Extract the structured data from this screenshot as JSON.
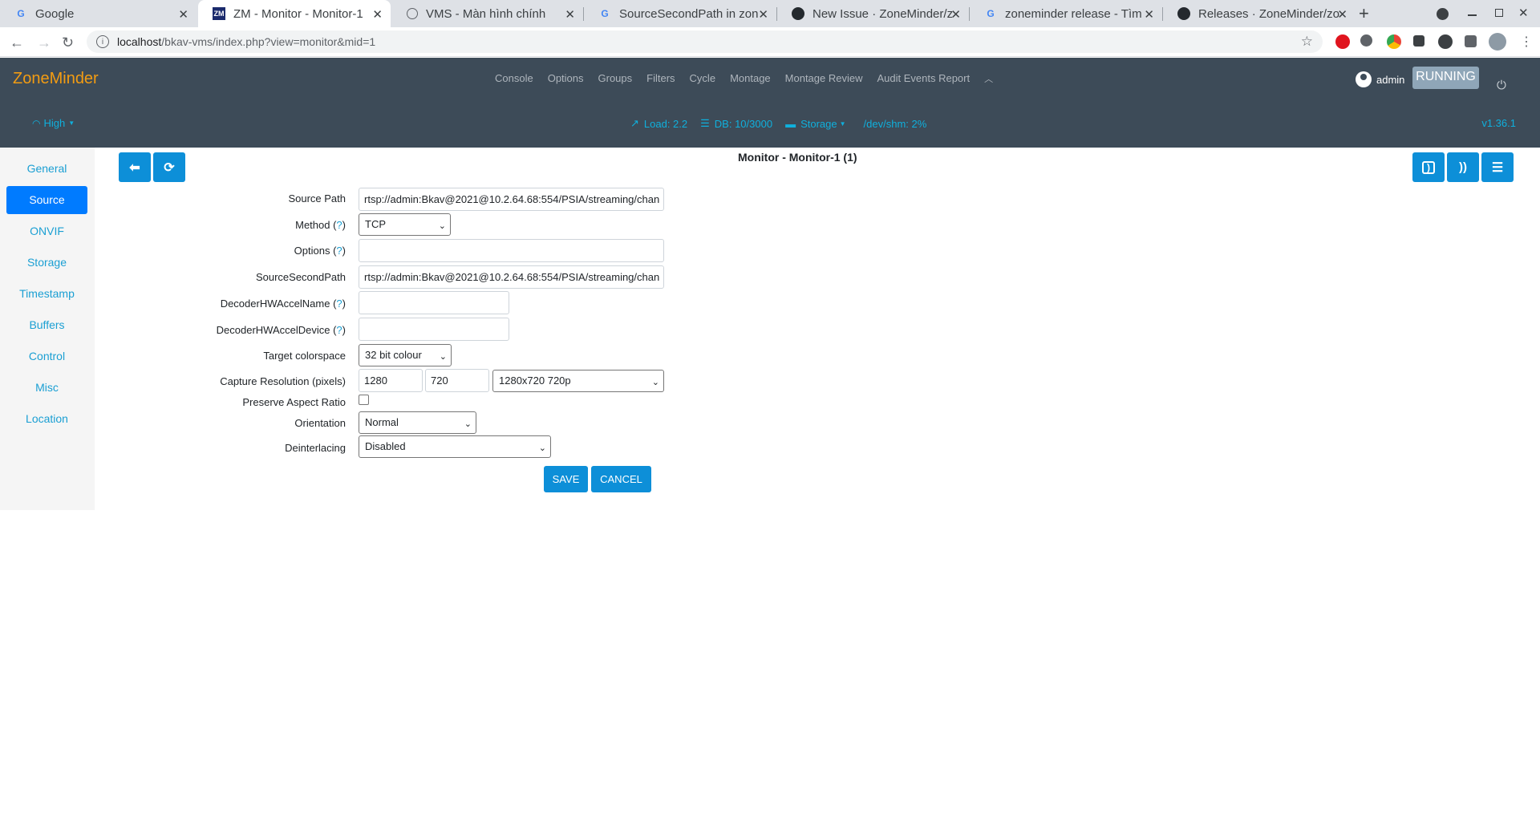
{
  "browser": {
    "tabs": [
      {
        "title": "Google",
        "favicon": "google-icon",
        "active": false
      },
      {
        "title": "ZM - Monitor - Monitor-1",
        "favicon": "zm-icon",
        "active": true
      },
      {
        "title": "VMS - Màn hình chính",
        "favicon": "globe-icon",
        "active": false
      },
      {
        "title": "SourceSecondPath in zon",
        "favicon": "google-icon",
        "active": false
      },
      {
        "title": "New Issue · ZoneMinder/z",
        "favicon": "github-icon",
        "active": false
      },
      {
        "title": "zoneminder release - Tìm",
        "favicon": "google-icon",
        "active": false
      },
      {
        "title": "Releases · ZoneMinder/zo",
        "favicon": "github-icon",
        "active": false
      }
    ],
    "new_tab": "+",
    "url_host": "localhost",
    "url_path": "/bkav-vms/index.php?view=monitor&mid=1"
  },
  "header": {
    "brand": "ZoneMinder",
    "nav": [
      "Console",
      "Options",
      "Groups",
      "Filters",
      "Cycle",
      "Montage",
      "Montage Review",
      "Audit Events Report"
    ],
    "collapse_icon": "chevron-up-icon",
    "user": "admin",
    "status": "RUNNING",
    "bandwidth": "High",
    "load": "Load: 2.2",
    "db": "DB: 10/3000",
    "storage": "Storage",
    "shm": "/dev/shm: 2%",
    "version": "v1.36.1"
  },
  "sidebar": {
    "items": [
      "General",
      "Source",
      "ONVIF",
      "Storage",
      "Timestamp",
      "Buffers",
      "Control",
      "Misc",
      "Location"
    ],
    "active": "Source"
  },
  "page": {
    "title": "Monitor - Monitor-1 (1)"
  },
  "form": {
    "source_path_label": "Source Path",
    "source_path_value": "rtsp://admin:Bkav@2021@10.2.64.68:554/PSIA/streaming/chan",
    "method_label": "Method (",
    "method_value": "TCP",
    "options_label": "Options (",
    "options_value": "",
    "second_path_label": "SourceSecondPath",
    "second_path_value": "rtsp://admin:Bkav@2021@10.2.64.68:554/PSIA/streaming/chan",
    "hw_name_label": "DecoderHWAccelName (",
    "hw_name_value": "",
    "hw_device_label": "DecoderHWAccelDevice  (",
    "hw_device_value": "",
    "colorspace_label": "Target colorspace",
    "colorspace_value": "32 bit colour",
    "resolution_label": "Capture Resolution (pixels)",
    "res_width": "1280",
    "res_height": "720",
    "res_preset": "1280x720 720p",
    "aspect_label": "Preserve Aspect Ratio",
    "aspect_checked": false,
    "orientation_label": "Orientation",
    "orientation_value": "Normal",
    "deinterlace_label": "Deinterlacing",
    "deinterlace_value": "Disabled",
    "help_mark": "?",
    "help_close": ")",
    "save": "SAVE",
    "cancel": "CANCEL"
  }
}
